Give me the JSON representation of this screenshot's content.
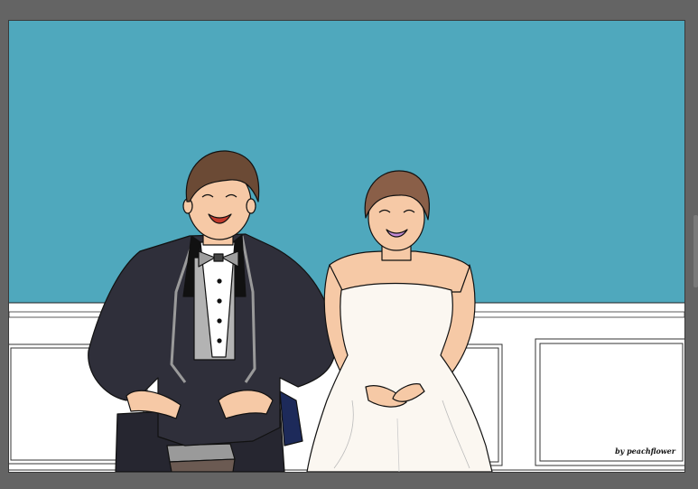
{
  "artwork": {
    "signature": "by peachflower",
    "colors": {
      "backdrop": "#646464",
      "sky": "#4fa8bd",
      "wall": "#ffffff",
      "suit": "#2f2f3a",
      "vest": "#b3b3b3",
      "skin": "#f6c9a6",
      "hair_groom": "#6b4a35",
      "hair_bride": "#8a5f48",
      "dress": "#fbf7f1",
      "lips": "#c33a2c",
      "bride_smile": "#c58bd6"
    }
  }
}
